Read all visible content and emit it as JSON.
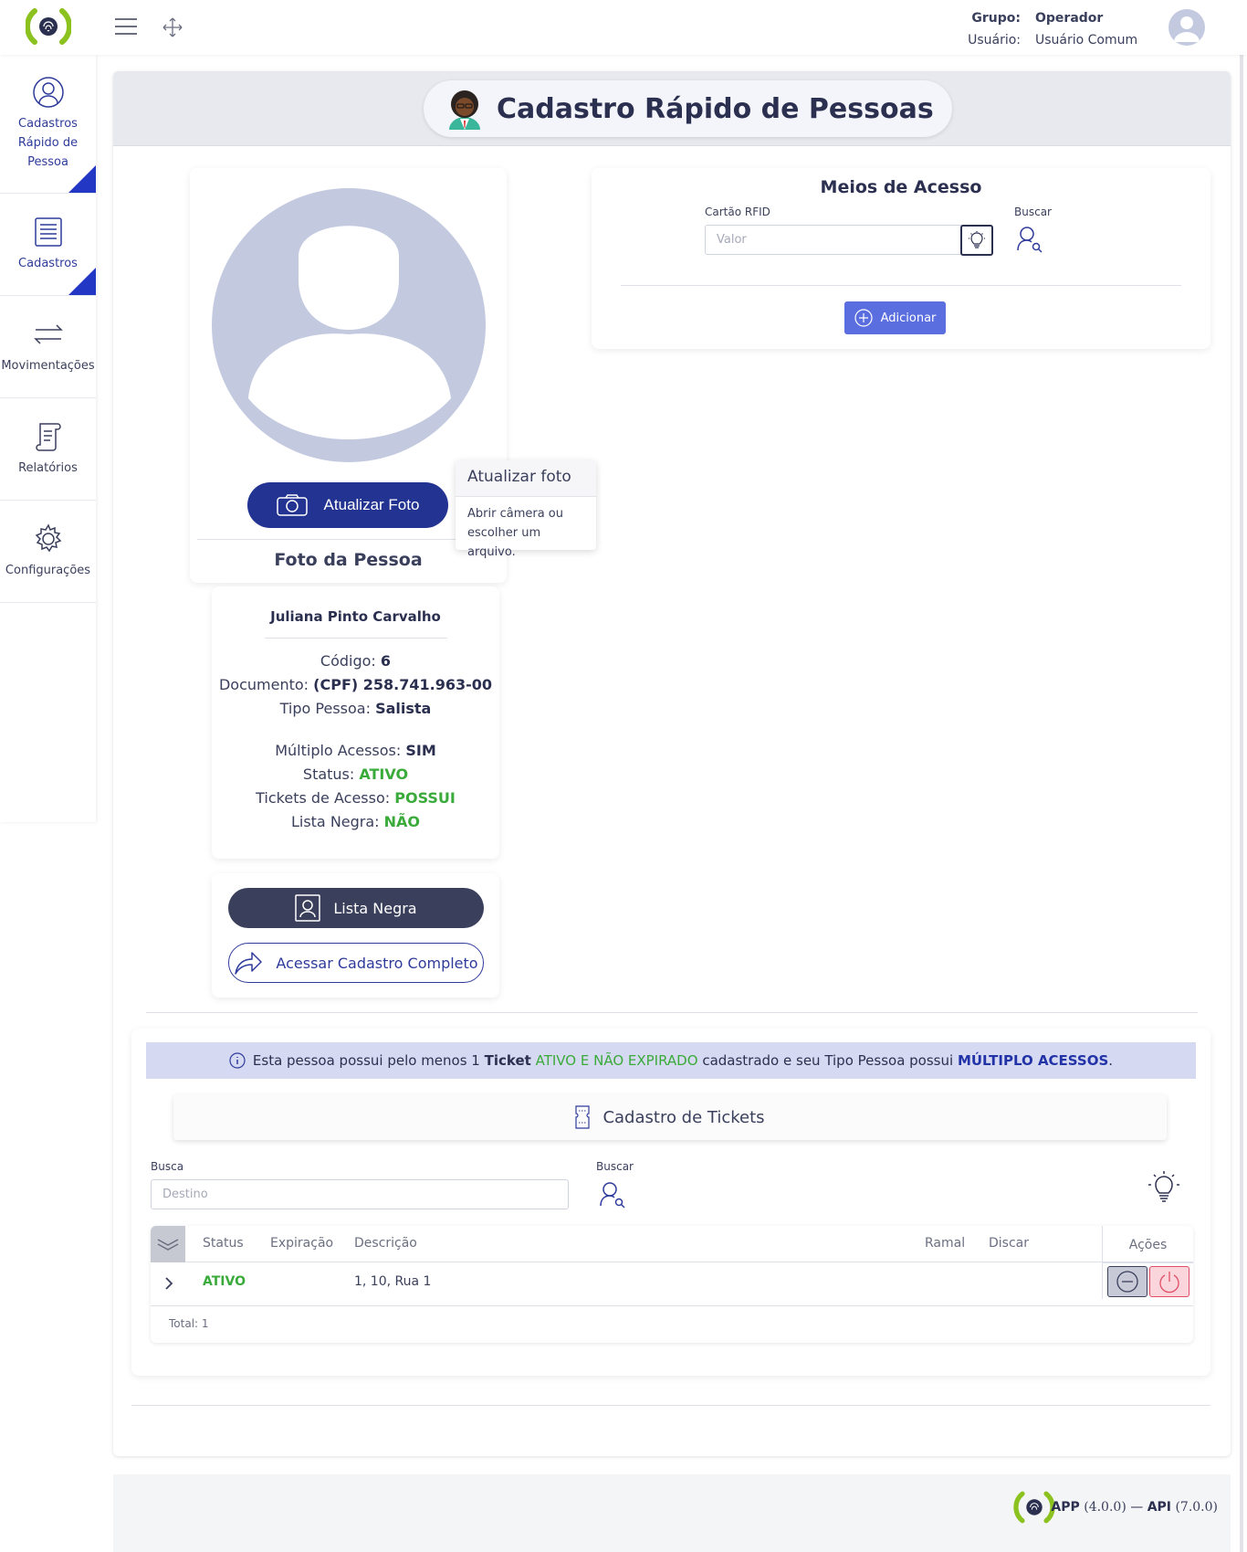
{
  "header": {
    "group_label": "Grupo:",
    "group_value": "Operador",
    "user_label": "Usuário:",
    "user_value": "Usuário Comum"
  },
  "sidebar": {
    "items": [
      {
        "label": "Cadastros Rápido de Pessoa",
        "icon": "user-circle-icon",
        "active": true
      },
      {
        "label": "Cadastros",
        "icon": "document-list-icon",
        "active": false
      },
      {
        "label": "Movimentações",
        "icon": "arrows-exchange-icon",
        "active": false
      },
      {
        "label": "Relatórios",
        "icon": "report-scroll-icon",
        "active": false
      },
      {
        "label": "Configurações",
        "icon": "gear-icon",
        "active": false
      }
    ]
  },
  "page": {
    "title": "Cadastro Rápido de Pessoas"
  },
  "photo": {
    "button_label": "Atualizar Foto",
    "caption": "Foto da Pessoa",
    "tooltip_title": "Atualizar foto",
    "tooltip_body": "Abrir câmera ou escolher um arquivo."
  },
  "person": {
    "name": "Juliana Pinto Carvalho",
    "codigo_label": "Código:",
    "codigo": "6",
    "documento_label": "Documento:",
    "documento": "(CPF) 258.741.963-00",
    "tipo_label": "Tipo Pessoa:",
    "tipo": "Salista",
    "multiplo_label": "Múltiplo Acessos:",
    "multiplo": "SIM",
    "status_label": "Status:",
    "status": "ATIVO",
    "tickets_label": "Tickets de Acesso:",
    "tickets": "POSSUI",
    "lista_label": "Lista Negra:",
    "lista": "NÃO"
  },
  "actions": {
    "lista_negra": "Lista Negra",
    "acessar": "Acessar Cadastro Completo"
  },
  "meios": {
    "title": "Meios de Acesso",
    "rfid_label": "Cartão RFID",
    "rfid_placeholder": "Valor",
    "buscar_label": "Buscar",
    "add_label": "Adicionar"
  },
  "tickets": {
    "alert_pre": "Esta pessoa possui pelo menos 1",
    "alert_ticket": "Ticket",
    "alert_green": "ATIVO E NÃO EXPIRADO",
    "alert_mid": "cadastrado e seu Tipo Pessoa possui",
    "alert_blue": "MÚLTIPLO ACESSOS",
    "alert_end": ".",
    "section_title": "Cadastro de Tickets",
    "busca_label": "Busca",
    "busca_placeholder": "Destino",
    "buscar_label": "Buscar",
    "columns": {
      "status": "Status",
      "expiracao": "Expiração",
      "descricao": "Descrição",
      "ramal": "Ramal",
      "discar": "Discar",
      "acoes": "Ações"
    },
    "rows": [
      {
        "status": "ATIVO",
        "expiracao": "",
        "descricao": "1, 10, Rua 1",
        "ramal": "",
        "discar": ""
      }
    ],
    "total": "Total: 1"
  },
  "footer": {
    "app_label": "APP",
    "app_version": "(4.0.0)",
    "separator": "—",
    "api_label": "API",
    "api_version": "(7.0.0)"
  },
  "colors": {
    "primary": "#233391",
    "accent_green": "#3aaa3a",
    "logo_green": "#8cc21f",
    "danger": "#e04f66"
  }
}
